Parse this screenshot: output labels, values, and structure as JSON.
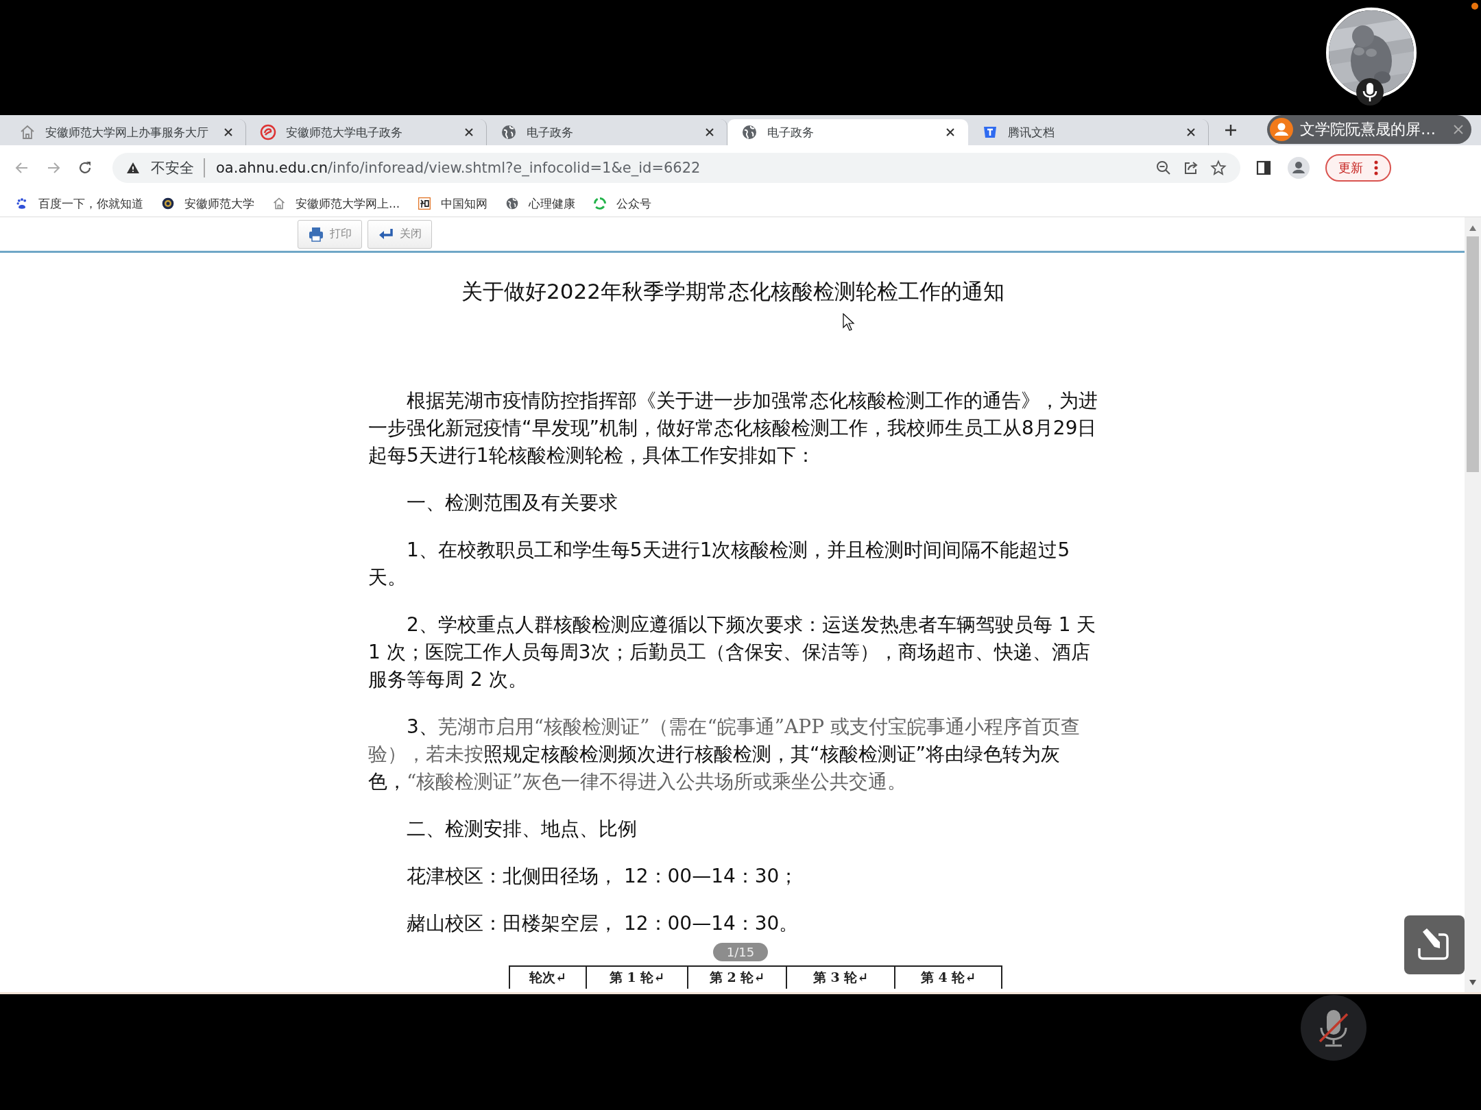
{
  "screen_share": {
    "presenter": "文学院阮熹晟的屏…"
  },
  "tabs": [
    {
      "title": "安徽师范大学网上办事服务大厅",
      "kind": "house",
      "selected": false
    },
    {
      "title": "安徽师范大学电子政务",
      "kind": "logo",
      "selected": false
    },
    {
      "title": "电子政务",
      "kind": "globe",
      "selected": false
    },
    {
      "title": "电子政务",
      "kind": "globe",
      "selected": true
    },
    {
      "title": "腾讯文档",
      "kind": "docs",
      "selected": false
    }
  ],
  "address_bar": {
    "security": "不安全",
    "host": "oa.ahnu.edu.cn",
    "path": "/info/inforead/view.shtml?e_infocolid=1&e_id=6622",
    "update_button": "更新"
  },
  "bookmarks": [
    {
      "label": "百度一下，你就知道",
      "kind": "paw"
    },
    {
      "label": "安徽师范大学",
      "kind": "seal"
    },
    {
      "label": "安徽师范大学网上...",
      "kind": "house"
    },
    {
      "label": "中国知网",
      "kind": "zhi"
    },
    {
      "label": "心理健康",
      "kind": "globe"
    },
    {
      "label": "公众号",
      "kind": "swirl"
    }
  ],
  "document": {
    "toolbar": [
      {
        "label": "打印",
        "kind": "print"
      },
      {
        "label": "关闭",
        "kind": "back"
      }
    ],
    "title": "关于做好2022年秋季学期常态化核酸检测轮检工作的通知",
    "paragraphs": [
      "根据芜湖市疫情防控指挥部《关于进一步加强常态化核酸检测工作的通告》，为进一步强化新冠疫情“早发现”机制，做好常态化核酸检测工作，我校师生员工从8月29日起每5天进行1轮核酸检测轮检，具体工作安排如下：",
      "一、检测范围及有关要求",
      "1、在校教职员工和学生每5天进行1次核酸检测，并且检测时间间隔不能超过5天。",
      "2、学校重点人群核酸检测应遵循以下频次要求：运送发热患者车辆驾驶员每 1 天 1 次；医院工作人员每周3次；后勤员工（含保安、保洁等），商场超市、快递、酒店服务等每周 2 次。",
      {
        "kind": "mixed",
        "segments": [
          {
            "text": "3、",
            "muted": false
          },
          {
            "text": "芜湖市启用“核酸检测证”（需在“皖事通”APP 或支付宝皖事通小程序首页查验），若未按",
            "muted": true
          },
          {
            "text": "照规定核酸检测频次进行核酸检测，其“核酸检测证”将由绿色转为灰色，",
            "muted": false
          },
          {
            "text": "“核酸检测证”灰色一律不得进入公共场所或乘坐公共交通。",
            "muted": true
          }
        ]
      },
      "二、检测安排、地点、比例",
      "花津校区：北侧田径场， 12：00—14：30；",
      "赭山校区：田楼架空层， 12：00—14：30。"
    ],
    "table_header": [
      "轮次↵",
      "第 1 轮↵",
      "第 2 轮↵",
      "第 3 轮↵",
      "第 4 轮↵"
    ]
  },
  "page_indicator": "1/15"
}
